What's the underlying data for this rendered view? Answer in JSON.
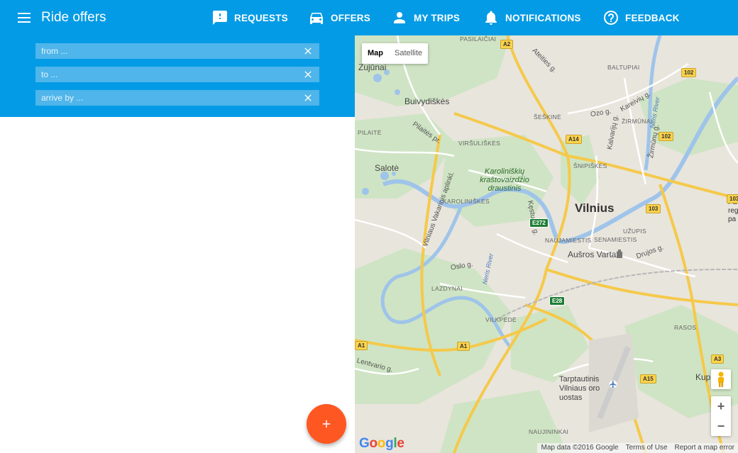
{
  "app": {
    "title": "Ride offers"
  },
  "nav": [
    {
      "label": "REQUESTS",
      "icon": "feedback-exclamation-icon"
    },
    {
      "label": "OFFERS",
      "icon": "car-icon"
    },
    {
      "label": "MY TRIPS",
      "icon": "person-icon"
    },
    {
      "label": "NOTIFICATIONS",
      "icon": "bell-icon"
    },
    {
      "label": "FEEDBACK",
      "icon": "help-circle-icon"
    }
  ],
  "search": {
    "from": {
      "label": "from",
      "value": "..."
    },
    "to": {
      "label": "to",
      "value": "..."
    },
    "arrive_by": {
      "label": "arrive by",
      "value": "..."
    }
  },
  "map": {
    "type_map": "Map",
    "type_satellite": "Satellite",
    "zoom_in": "+",
    "zoom_out": "−",
    "logo": "Google",
    "footer": {
      "data": "Map data ©2016 Google",
      "terms": "Terms of Use",
      "report": "Report a map error"
    },
    "labels": {
      "city": "Vilnius",
      "zujunai": "Zujūnai",
      "buivydiskes": "Buivydiškės",
      "salote": "Salotė",
      "ausros_vartai": "Aušros Vartai",
      "kuprioniskes": "Kuprioniš",
      "airport": "Tarptautinis Vilniaus oro uostas",
      "park": "Karoliniškių kraštovaizdžio draustinis",
      "pasilaiciai": "PASILAIČIAI",
      "baltupiai": "BALTUPIAI",
      "seskine": "ŠEŠKINĖ",
      "zirmunai": "ŽIRMŪNAI",
      "virsuliskes": "VIRŠULIŠKĖS",
      "snipiskes": "ŠNIPIŠKĖS",
      "pilaite": "PILAITĖ",
      "karoliniskes": "KAROLINIŠKĖS",
      "naujamiestis": "NAUJAMIESTIS",
      "senamiestis": "SENAMIESTIS",
      "uzupis": "UŽUPIS",
      "lazdynai": "LAZDYNAI",
      "vilkpede": "VILKPĖDĖ",
      "rasos": "RASOS",
      "naujininkai": "NAUJININKAI",
      "neris_river": "Neris River",
      "neris_river_2": "Neris River",
      "oslo": "Oslo g.",
      "lentvario": "Lentvario g.",
      "drujos": "Drujos g.",
      "pilaites": "Pilaitės pr.",
      "vakarinis": "Vilniaus Vakarinis aplinkl.",
      "ateities": "Ateities g.",
      "ozo": "Ozo g.",
      "kareiviu": "Kareivių g.",
      "kalvariju": "Kalvarijų g.",
      "zirmunu": "Žirmūnų g.",
      "kestucio": "Kęstučio g.",
      "right_edge": "Pa reg pa"
    },
    "shields": {
      "a2": "A2",
      "a14": "A14",
      "e272": "E272",
      "e28": "E28",
      "a1": "A1",
      "a1b": "A1",
      "a3": "A3",
      "a15": "A15",
      "r102": "102",
      "r102b": "102",
      "r103": "103",
      "r103b": "103"
    }
  }
}
